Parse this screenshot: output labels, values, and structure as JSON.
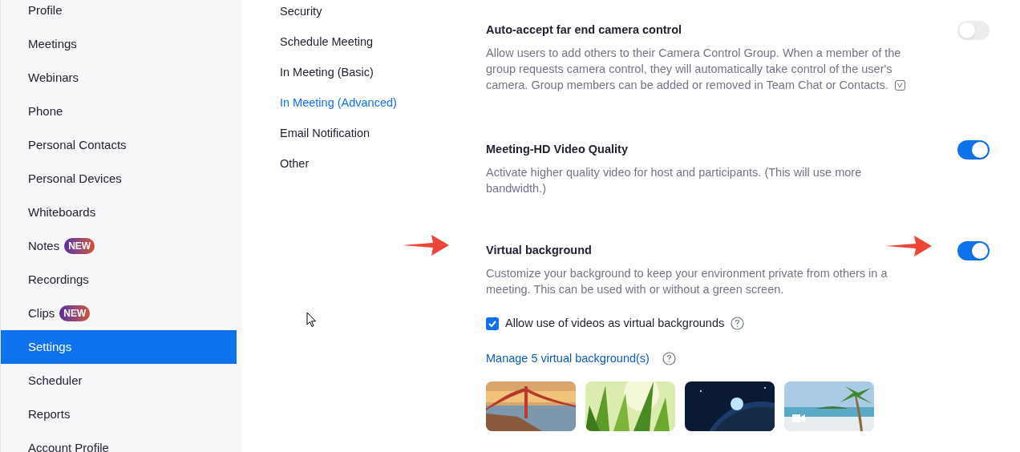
{
  "sidebar": {
    "items": [
      {
        "label": "Profile",
        "selected": false
      },
      {
        "label": "Meetings",
        "selected": false
      },
      {
        "label": "Webinars",
        "selected": false
      },
      {
        "label": "Phone",
        "selected": false
      },
      {
        "label": "Personal Contacts",
        "selected": false
      },
      {
        "label": "Personal Devices",
        "selected": false
      },
      {
        "label": "Whiteboards",
        "selected": false
      },
      {
        "label": "Notes",
        "selected": false,
        "badge": "NEW"
      },
      {
        "label": "Recordings",
        "selected": false
      },
      {
        "label": "Clips",
        "selected": false,
        "badge": "NEW"
      },
      {
        "label": "Settings",
        "selected": true
      },
      {
        "label": "Scheduler",
        "selected": false
      },
      {
        "label": "Reports",
        "selected": false
      },
      {
        "label": "Account Profile",
        "selected": false
      }
    ]
  },
  "section_nav": [
    {
      "label": "Security",
      "selected": false
    },
    {
      "label": "Schedule Meeting",
      "selected": false
    },
    {
      "label": "In Meeting (Basic)",
      "selected": false
    },
    {
      "label": "In Meeting (Advanced)",
      "selected": true
    },
    {
      "label": "Email Notification",
      "selected": false
    },
    {
      "label": "Other",
      "selected": false
    }
  ],
  "settings": [
    {
      "title": "Auto-accept far end camera control",
      "description": "Allow users to add others to their Camera Control Group. When a member of the group requests camera control, they will automatically take control of the user's camera. Group members can be added or removed in Team Chat or Contacts.",
      "on": false,
      "annotated": false,
      "info_icon": true
    },
    {
      "title": "Meeting-HD Video Quality",
      "description": "Activate higher quality video for host and participants. (This will use more bandwidth.)",
      "on": true,
      "annotated": false,
      "info_icon": false
    },
    {
      "title": "Virtual background",
      "description": "Customize your background to keep your environment private from others in a meeting. This can be used with or without a green screen.",
      "on": true,
      "annotated": true,
      "info_icon": false,
      "option": {
        "label": "Allow use of videos as virtual backgrounds",
        "checked": true
      },
      "manage_link": "Manage 5 virtual background(s)",
      "backgrounds": [
        {
          "kind": "bridge",
          "video": false
        },
        {
          "kind": "grass",
          "video": false
        },
        {
          "kind": "earth",
          "video": false
        },
        {
          "kind": "beach",
          "video": true
        }
      ]
    }
  ]
}
